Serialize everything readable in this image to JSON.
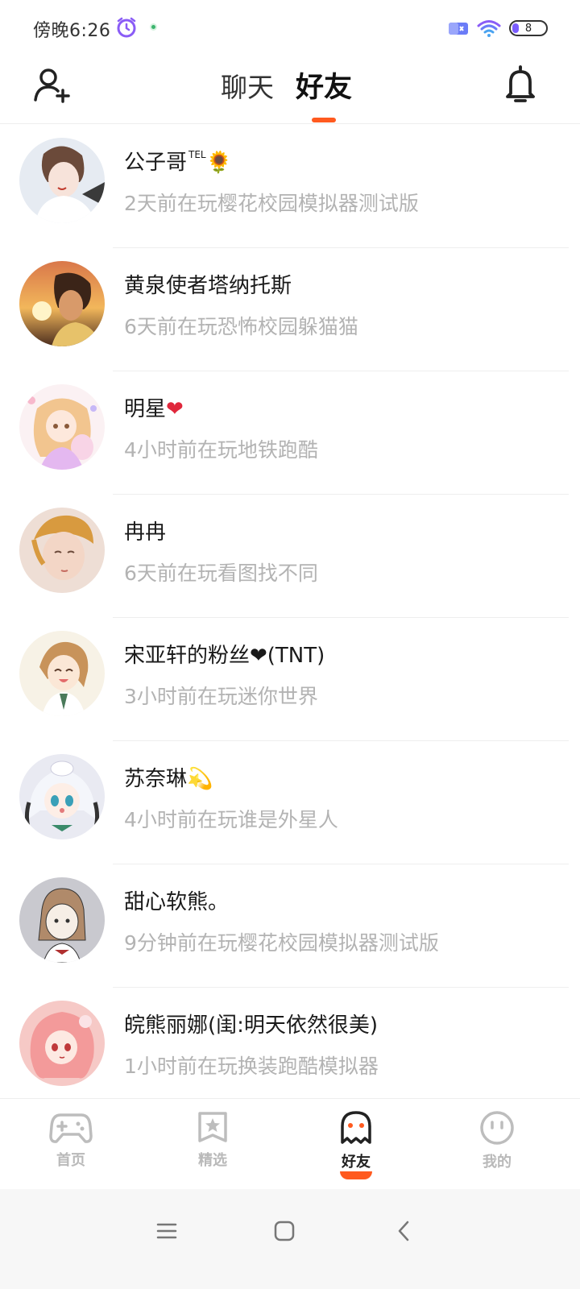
{
  "status_bar": {
    "time": "傍晚6:26",
    "battery_level": "8"
  },
  "header": {
    "tabs": [
      {
        "label": "聊天",
        "active": false
      },
      {
        "label": "好友",
        "active": true
      }
    ]
  },
  "friends": [
    {
      "name": "公子哥",
      "name_sup": "TEL",
      "name_emoji": "🌻",
      "status": "2天前在玩樱花校园模拟器测试版"
    },
    {
      "name": "黄泉使者塔纳托斯",
      "name_sup": "",
      "name_emoji": "",
      "status": "6天前在玩恐怖校园躲猫猫"
    },
    {
      "name": "明星",
      "name_sup": "",
      "name_emoji": "❤",
      "status": "4小时前在玩地铁跑酷"
    },
    {
      "name": "冉冉",
      "name_sup": "",
      "name_emoji": "",
      "status": "6天前在玩看图找不同"
    },
    {
      "name": "宋亚轩的粉丝❤(TNT)",
      "name_sup": "",
      "name_emoji": "",
      "status": "3小时前在玩迷你世界"
    },
    {
      "name": "苏奈琳",
      "name_sup": "",
      "name_emoji": "💫",
      "status": "4小时前在玩谁是外星人"
    },
    {
      "name": "甜心软熊。",
      "name_sup": "",
      "name_emoji": "",
      "status": "9分钟前在玩樱花校园模拟器测试版"
    },
    {
      "name": "皖熊丽娜(闺:明天依然很美)",
      "name_sup": "",
      "name_emoji": "",
      "status": "1小时前在玩换装跑酷模拟器"
    }
  ],
  "bottom_nav": [
    {
      "label": "首页",
      "icon": "gamepad-icon",
      "active": false
    },
    {
      "label": "精选",
      "icon": "star-badge-icon",
      "active": false
    },
    {
      "label": "好友",
      "icon": "ghost-icon",
      "active": true
    },
    {
      "label": "我的",
      "icon": "face-icon",
      "active": false
    }
  ],
  "colors": {
    "accent": "#ff5a1f",
    "secondary_text": "#b3b3b3",
    "divider": "#eeeeee"
  }
}
